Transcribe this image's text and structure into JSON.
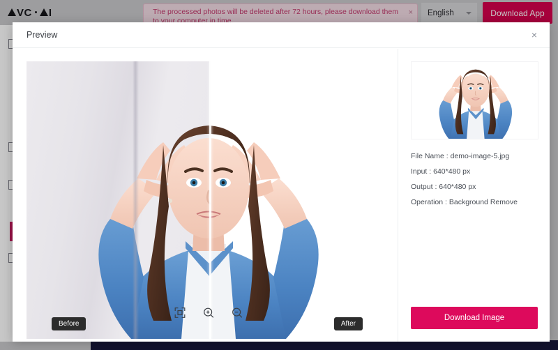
{
  "app": {
    "logo_text": "AVC·AI",
    "logo_parts": {
      "a1": "A",
      "vc": "VC",
      "dot": "·",
      "a2": "A",
      "i": "I"
    }
  },
  "notice": {
    "message": "The processed photos will be deleted after 72 hours, please download them to your computer in time.",
    "close_label": "×"
  },
  "header": {
    "language": "English",
    "download_app_label": "Download App"
  },
  "modal": {
    "title": "Preview",
    "close_label": "×"
  },
  "preview": {
    "before_label": "Before",
    "after_label": "After",
    "tools": [
      {
        "name": "fit-screen",
        "label": "Fit to screen"
      },
      {
        "name": "zoom-in",
        "label": "Zoom in"
      },
      {
        "name": "zoom-out",
        "label": "Zoom out"
      }
    ]
  },
  "info": {
    "file_name": "File Name : demo-image-5.jpg",
    "input": "Input : 640*480 px",
    "output": "Output : 640*480 px",
    "operation": "Operation : Background Remove",
    "download_image_label": "Download Image"
  },
  "colors": {
    "brand_pink": "#dd0a5c",
    "download_app_pink": "#d6004e",
    "notice_text": "#c2386c",
    "notice_bg": "#f3dbe4",
    "bottom_bar": "#17163a"
  }
}
